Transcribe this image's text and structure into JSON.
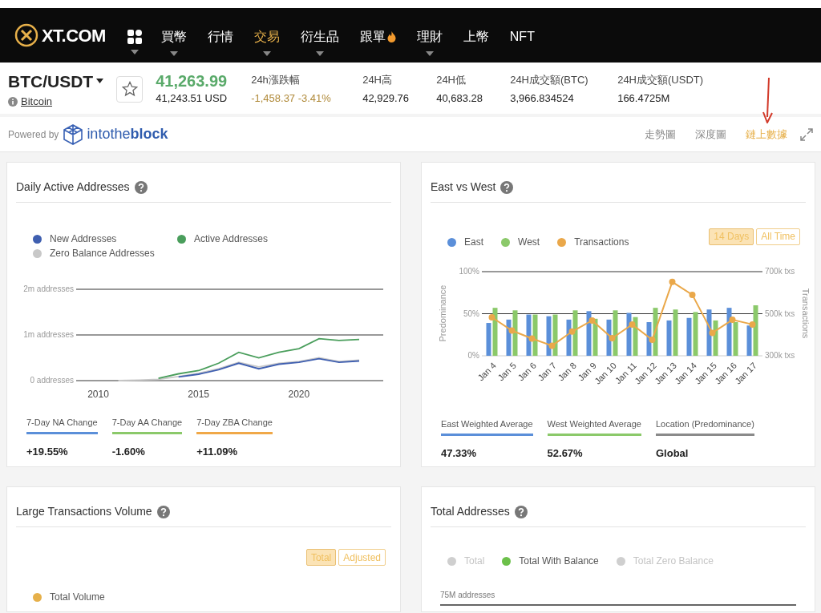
{
  "header": {
    "logo": "XT.COM",
    "nav": [
      {
        "label": "買幣",
        "dropdown": true,
        "selected": false,
        "hot": false
      },
      {
        "label": "行情",
        "dropdown": false,
        "selected": false,
        "hot": false
      },
      {
        "label": "交易",
        "dropdown": true,
        "selected": true,
        "hot": false
      },
      {
        "label": "衍生品",
        "dropdown": true,
        "selected": false,
        "hot": false
      },
      {
        "label": "跟單",
        "dropdown": false,
        "selected": false,
        "hot": true
      },
      {
        "label": "理財",
        "dropdown": true,
        "selected": false,
        "hot": false
      },
      {
        "label": "上幣",
        "dropdown": false,
        "selected": false,
        "hot": false
      },
      {
        "label": "NFT",
        "dropdown": false,
        "selected": false,
        "hot": false
      }
    ]
  },
  "ticker": {
    "pair": "BTC/USDT",
    "name": "Bitcoin",
    "price": "41,263.99",
    "price_usd": "41,243.51 USD",
    "stats": [
      {
        "label": "24h漲跌幅",
        "value": "-1,458.37 -3.41%",
        "kind": "change"
      },
      {
        "label": "24H高",
        "value": "42,929.76",
        "kind": "plain"
      },
      {
        "label": "24H低",
        "value": "40,683.28",
        "kind": "plain"
      },
      {
        "label": "24H成交額(BTC)",
        "value": "3,966.834524",
        "kind": "plain"
      },
      {
        "label": "24H成交額(USDT)",
        "value": "166.4725M",
        "kind": "plain"
      }
    ]
  },
  "powered_by": {
    "text": "Powered by",
    "brand_plain": "intothe",
    "brand_bold": "block"
  },
  "view_tabs": [
    {
      "label": "走勢圖",
      "selected": false
    },
    {
      "label": "深度圖",
      "selected": false
    },
    {
      "label": "鏈上數據",
      "selected": true
    }
  ],
  "cards": [
    {
      "title": "Daily Active Addresses",
      "kind": "lines",
      "chart_data": {
        "type": "line",
        "x": [
          2011,
          2012,
          2013,
          2014,
          2015,
          2016,
          2017,
          2018,
          2019,
          2020,
          2021,
          2022,
          2023
        ],
        "xticks": [
          2010,
          2015,
          2020
        ],
        "xlim": [
          2008.9,
          2024.2
        ],
        "ylim": [
          0,
          2000000
        ],
        "yticks": [
          {
            "value": 0,
            "label": "0 addresses"
          },
          {
            "value": 1000000,
            "label": "1m addresses"
          },
          {
            "value": 2000000,
            "label": "2m addresses"
          }
        ],
        "series": [
          {
            "name": "New Addresses",
            "color": "#3f5fb0",
            "values": [
              null,
              null,
              null,
              80000,
              140000,
              240000,
              380000,
              260000,
              360000,
              400000,
              480000,
              400000,
              430000
            ]
          },
          {
            "name": "Active Addresses",
            "color": "#4a9e5c",
            "values": [
              null,
              null,
              50000,
              150000,
              220000,
              380000,
              620000,
              500000,
              620000,
              700000,
              920000,
              880000,
              900000
            ]
          },
          {
            "name": "Zero Balance Addresses",
            "color": "#c8c8c8",
            "values": [
              0,
              10000,
              30000,
              90000,
              160000,
              260000,
              400000,
              300000,
              380000,
              420000,
              500000,
              420000,
              450000
            ]
          }
        ]
      },
      "summary": [
        {
          "label": "7-Day NA Change",
          "value": "+19.55%",
          "color": "#5b8fd9"
        },
        {
          "label": "7-Day AA Change",
          "value": "-1.60%",
          "color": "#8bc96a"
        },
        {
          "label": "7-Day ZBA Change",
          "value": "+11.09%",
          "color": "#f0a848"
        }
      ]
    },
    {
      "title": "East vs West",
      "kind": "bars",
      "toggles": [
        {
          "label": "14 Days",
          "selected": true
        },
        {
          "label": "All Time",
          "selected": false
        }
      ],
      "chart_data": {
        "type": "bar",
        "ylabel": "Predominance",
        "categories": [
          "Jan 4",
          "Jan 5",
          "Jan 6",
          "Jan 7",
          "Jan 8",
          "Jan 9",
          "Jan 10",
          "Jan 11",
          "Jan 12",
          "Jan 13",
          "Jan 14",
          "Jan 15",
          "Jan 16",
          "Jan 17"
        ],
        "ylim": [
          0,
          100
        ],
        "yticks": [
          {
            "value": 0,
            "label": "0%"
          },
          {
            "value": 50,
            "label": "50%"
          },
          {
            "value": 100,
            "label": "100%"
          }
        ],
        "series": [
          {
            "name": "East",
            "color": "#5b8fd9",
            "values": [
              39,
              43,
              49,
              47,
              43,
              53,
              43,
              51,
              40,
              42,
              45,
              55,
              57,
              36
            ]
          },
          {
            "name": "West",
            "color": "#8bc96a",
            "values": [
              57,
              54,
              49,
              49,
              54,
              44,
              54,
              46,
              57,
              55,
              52,
              42,
              40,
              60
            ]
          }
        ]
      },
      "overlay": {
        "chart_data": {
          "type": "line",
          "ylabel": "Transactions",
          "categories": [
            null,
            null,
            null,
            null,
            null,
            null,
            null,
            null,
            null,
            null,
            null,
            null,
            null,
            null
          ],
          "ylim": [
            300000,
            700000
          ],
          "yticks": [
            {
              "value": 300000,
              "label": "300k txs"
            },
            {
              "value": 500000,
              "label": "500k txs"
            },
            {
              "value": 700000,
              "label": "700k txs"
            }
          ],
          "series": [
            {
              "name": "Transactions",
              "color": "#eaa84a",
              "marker": "circle",
              "values": [
                483000,
                420000,
                382000,
                348000,
                415000,
                468000,
                384000,
                449000,
                376000,
                651000,
                590000,
                409000,
                471000,
                449000
              ]
            }
          ]
        }
      },
      "summary": [
        {
          "label": "East Weighted Average",
          "value": "47.33%",
          "color": "#5b8fd9"
        },
        {
          "label": "West Weighted Average",
          "value": "52.67%",
          "color": "#8bc96a"
        },
        {
          "label": "Location (Predominance)",
          "value": "Global",
          "color": "#8a8a8a"
        }
      ]
    },
    {
      "title": "Large Transactions Volume",
      "kind": "volume",
      "toggles": [
        {
          "label": "Total",
          "selected": true
        },
        {
          "label": "Adjusted",
          "selected": false
        }
      ],
      "legend": [
        {
          "label": "Total Volume",
          "color": "#e6b04a"
        }
      ]
    },
    {
      "title": "Total Addresses",
      "kind": "addresses",
      "legend": [
        {
          "label": "Total",
          "color": "#cfcfcf",
          "on": false
        },
        {
          "label": "Total With Balance",
          "color": "#6cc04a",
          "on": true
        },
        {
          "label": "Total Zero Balance",
          "color": "#cfcfcf",
          "on": false
        }
      ],
      "gridline": "75M addresses"
    }
  ]
}
